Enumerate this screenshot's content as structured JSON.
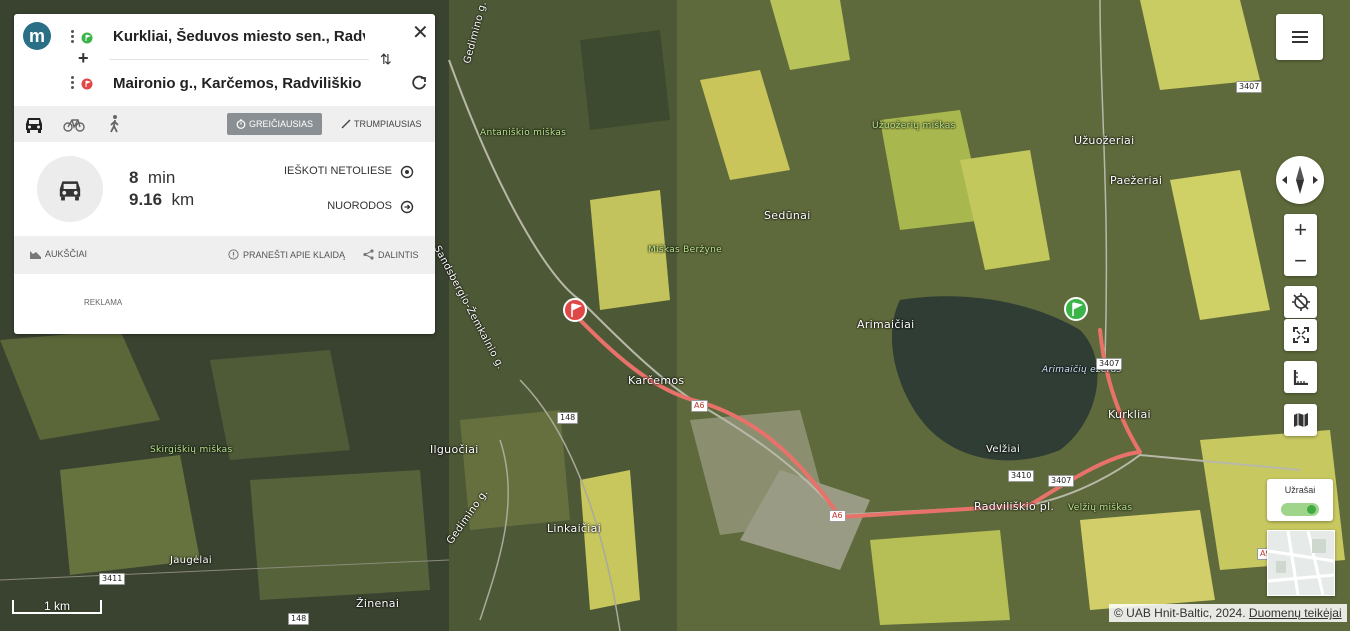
{
  "panel": {
    "logo_letter": "m",
    "from": "Kurkliai, Šeduvos miesto sen., Radviliškio",
    "to": "Maironio g., Karčemos, Radviliškio sen.,",
    "close": "✕",
    "add": "+",
    "swap": "⇅",
    "modes": [
      "car-icon",
      "bicycle-icon",
      "walk-icon"
    ],
    "fastest_label": "GREIČIAUSIAS",
    "shortest_label": "TRUMPIAUSIAS",
    "route": {
      "time_value": "8",
      "time_unit": "min",
      "distance_value": "9.16",
      "distance_unit": "km"
    },
    "search_nearby": "IEŠKOTI NETOLIESE",
    "directions": "NUORODOS",
    "elevation": "AUKŠČIAI",
    "report_error": "PRANEŠTI APIE KLAIDĄ",
    "share": "DALINTIS",
    "ad_label": "REKLAMA"
  },
  "map": {
    "labels": [
      "Antaniškio miškas",
      "Užuožerių miškas",
      "Užuožeriai",
      "Paežeriai",
      "Sedūnai",
      "Miškas Beržyne",
      "Arimaičiai",
      "Arimaičių ežeras",
      "Kurkliai",
      "Karčemos",
      "Velžiai",
      "Radviliškio pl.",
      "Velžių miškas",
      "Skirgiškių miškas",
      "Ilguočiai",
      "Linkaičiai",
      "Jaugėlai",
      "Žinenai",
      "Sandsbergio-Žemkalnio g.",
      "Gedimino g.",
      "Gedimino g."
    ],
    "road_shields": [
      "3407",
      "3407",
      "3407",
      "3410",
      "148",
      "148",
      "A6",
      "A6",
      "A9",
      "3411"
    ],
    "route_color": "#e8726a",
    "start_flag_color": "#3bb54a",
    "end_flag_color": "#e04848"
  },
  "controls": {
    "labels_toggle": "Užrašai",
    "labels_on": true
  },
  "scale": "1 km",
  "attribution": {
    "text": "© UAB Hnit-Baltic, 2024.",
    "link": "Duomenų teikėjai"
  }
}
